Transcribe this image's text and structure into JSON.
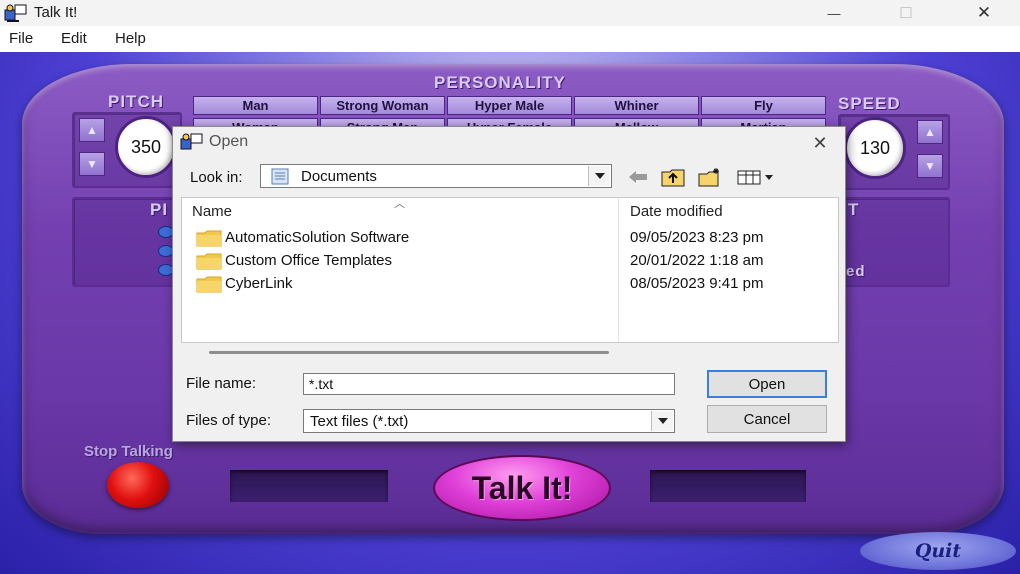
{
  "window": {
    "title": "Talk It!",
    "controls": {
      "minimize": "—",
      "maximize": "☐",
      "close": "✕"
    }
  },
  "menu": {
    "items": [
      "File",
      "Edit",
      "Help"
    ]
  },
  "app": {
    "personality_label": "PERSONALITY",
    "personality_row1": [
      "Man",
      "Strong Woman",
      "Hyper Male",
      "Whiner",
      "Fly"
    ],
    "personality_row2_partial": [
      "Woman",
      "Strong Man",
      "Hyper Female",
      "Mellow",
      "Martian"
    ],
    "pitch_label": "PITCH",
    "pitch_value": "350",
    "speed_label": "SPEED",
    "speed_value": "130",
    "left_panel_fragment": "PI",
    "right_panel_fragment": "T",
    "right_panel_fragment2": "ed",
    "stop_label": "Stop Talking",
    "talk_button": "Talk It!",
    "quit_button": "Quit",
    "colors": {
      "console": "#7440b1",
      "background": "#4d40d4",
      "talk": "#e040d8",
      "stop": "#e01010"
    }
  },
  "dialog": {
    "title": "Open",
    "look_in_label": "Look in:",
    "look_in_value": "Documents",
    "toolbar_icons": [
      "back-arrow-icon",
      "up-folder-icon",
      "new-folder-icon",
      "view-menu-icon"
    ],
    "columns": {
      "name": "Name",
      "date": "Date modified"
    },
    "files": [
      {
        "name": "AutomaticSolution Software",
        "date": "09/05/2023 8:23 pm"
      },
      {
        "name": "Custom Office Templates",
        "date": "20/01/2022 1:18 am"
      },
      {
        "name": "CyberLink",
        "date": "08/05/2023 9:41 pm"
      }
    ],
    "file_name_label": "File name:",
    "file_name_value": "*.txt",
    "file_type_label": "Files of type:",
    "file_type_value": "Text files (*.txt)",
    "open_button": "Open",
    "cancel_button": "Cancel"
  }
}
